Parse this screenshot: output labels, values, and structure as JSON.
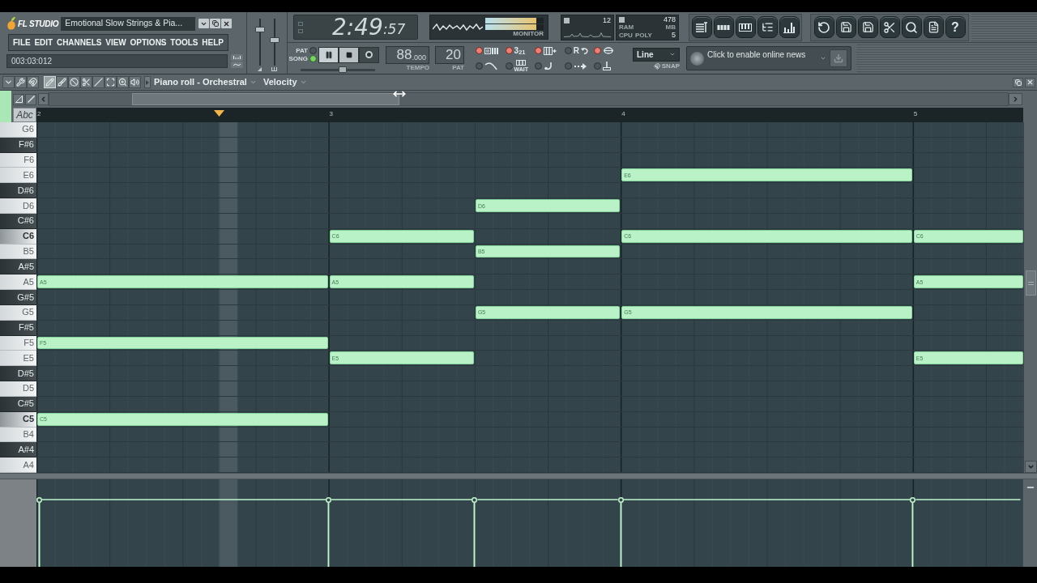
{
  "title_bar": {
    "app_name": "FL STUDIO",
    "song_title": "Emotional Slow Strings & Pia..."
  },
  "menu": [
    {
      "label": "FILE"
    },
    {
      "label": "EDIT"
    },
    {
      "label": "CHANNELS"
    },
    {
      "label": "VIEW"
    },
    {
      "label": "OPTIONS"
    },
    {
      "label": "TOOLS"
    },
    {
      "label": "HELP"
    }
  ],
  "hint_bar": {
    "text": "003:03:012"
  },
  "master_sliders": [
    {
      "kind": "volume",
      "level": 0.8
    },
    {
      "kind": "pitch",
      "level": 0.55
    }
  ],
  "time_display": {
    "main": "2:49",
    "small": ":57"
  },
  "monitor": {
    "label": "MONITOR",
    "meters": [
      {
        "level": 0.88
      },
      {
        "level": 0.88
      }
    ]
  },
  "cpu": {
    "value": "12",
    "ram": "478",
    "ram_label": "RAM",
    "unit": "MB",
    "cpu_label": "CPU",
    "poly_label": "POLY",
    "poly": "5"
  },
  "view_buttons": [
    {
      "kind": "playlist"
    },
    {
      "kind": "step-sequencer"
    },
    {
      "kind": "piano-roll"
    },
    {
      "kind": "browser"
    },
    {
      "kind": "mixer"
    }
  ],
  "tool_buttons": [
    {
      "kind": "undo"
    },
    {
      "kind": "save-new"
    },
    {
      "kind": "export"
    },
    {
      "kind": "cut"
    },
    {
      "kind": "search"
    },
    {
      "kind": "info"
    },
    {
      "kind": "help",
      "label": "?"
    }
  ],
  "transport": {
    "modes": [
      {
        "label": "PAT",
        "selected": false
      },
      {
        "label": "SONG",
        "selected": true
      }
    ],
    "buttons": [
      {
        "kind": "pause"
      },
      {
        "kind": "stop"
      },
      {
        "kind": "record"
      }
    ],
    "position": {
      "level": 0.57
    }
  },
  "tempo": {
    "value": "88",
    "decimals": ".000",
    "label": "TEMPO"
  },
  "pattern": {
    "value": "20",
    "label": "PAT"
  },
  "toggles": [
    {
      "kind": "metronome",
      "on": true
    },
    {
      "kind": "countdown",
      "label": "3$_{21}$",
      "on": true
    },
    {
      "kind": "step-edit",
      "on": true
    },
    {
      "kind": "recording",
      "label": "R",
      "on": false
    },
    {
      "kind": "loop",
      "on": true
    },
    {
      "kind": "blend",
      "on": false
    },
    {
      "kind": "wait",
      "label": "WAIT",
      "on": false
    },
    {
      "kind": "pedal",
      "on": false
    },
    {
      "kind": "arrow",
      "on": false
    },
    {
      "kind": "typing",
      "on": false
    }
  ],
  "snap": {
    "value": "Line",
    "label": "SNAP"
  },
  "news": {
    "text": "Click to enable online news"
  },
  "piano_roll": {
    "tools": [
      {
        "kind": "menu",
        "selected": false
      },
      {
        "kind": "settings",
        "selected": false
      },
      {
        "kind": "snap",
        "selected": false
      },
      {
        "kind": "draw",
        "selected": true
      },
      {
        "kind": "paint",
        "selected": false
      },
      {
        "kind": "mute",
        "selected": false
      },
      {
        "kind": "slice",
        "selected": false
      },
      {
        "kind": "slip",
        "selected": false
      },
      {
        "kind": "select",
        "selected": false
      },
      {
        "kind": "zoom",
        "selected": false
      },
      {
        "kind": "playback",
        "selected": false
      }
    ],
    "title": "Piano roll - Orchestral",
    "target": "Velocity",
    "abc": "Abc",
    "bars": [
      {
        "label": "2"
      },
      {
        "label": "3"
      },
      {
        "label": "4"
      },
      {
        "label": "5"
      }
    ],
    "marker": {
      "level": 0.185
    },
    "keys": [
      {
        "label": "G6",
        "kind": "white"
      },
      {
        "label": "F#6",
        "kind": "black"
      },
      {
        "label": "F6",
        "kind": "white"
      },
      {
        "label": "E6",
        "kind": "white",
        "notes": [
          {
            "kind": "gap_bar"
          },
          {
            "kind": "gap_bar"
          },
          {
            "kind": "bar",
            "label": "E6"
          }
        ]
      },
      {
        "label": "D#6",
        "kind": "black"
      },
      {
        "label": "D6",
        "kind": "white",
        "notes": [
          {
            "kind": "gap_bar"
          },
          {
            "kind": "gap_half"
          },
          {
            "kind": "half",
            "label": "D6"
          }
        ]
      },
      {
        "label": "C#6",
        "kind": "black"
      },
      {
        "label": "C6",
        "kind": "octave",
        "notes": [
          {
            "kind": "gap_bar"
          },
          {
            "kind": "half",
            "label": "C6"
          },
          {
            "kind": "gap_half"
          },
          {
            "kind": "bar",
            "label": "C6"
          },
          {
            "kind": "half",
            "label": "C6"
          }
        ]
      },
      {
        "label": "B5",
        "kind": "white",
        "notes": [
          {
            "kind": "gap_bar"
          },
          {
            "kind": "gap_half"
          },
          {
            "kind": "half",
            "label": "B5"
          }
        ]
      },
      {
        "label": "A#5",
        "kind": "black"
      },
      {
        "label": "A5",
        "kind": "white",
        "notes": [
          {
            "kind": "bar",
            "label": "A5"
          },
          {
            "kind": "half",
            "label": "A5"
          },
          {
            "kind": "gap_half"
          },
          {
            "kind": "gap_bar"
          },
          {
            "kind": "half",
            "label": "A5"
          }
        ]
      },
      {
        "label": "G#5",
        "kind": "black"
      },
      {
        "label": "G5",
        "kind": "white",
        "notes": [
          {
            "kind": "gap_bar"
          },
          {
            "kind": "gap_half"
          },
          {
            "kind": "half",
            "label": "G5"
          },
          {
            "kind": "bar",
            "label": "G5"
          }
        ]
      },
      {
        "label": "F#5",
        "kind": "black"
      },
      {
        "label": "F5",
        "kind": "white",
        "notes": [
          {
            "kind": "bar",
            "label": "F5"
          }
        ]
      },
      {
        "label": "E5",
        "kind": "white",
        "notes": [
          {
            "kind": "gap_bar"
          },
          {
            "kind": "half",
            "label": "E5"
          },
          {
            "kind": "gap_half"
          },
          {
            "kind": "gap_bar"
          },
          {
            "kind": "half",
            "label": "E5"
          }
        ]
      },
      {
        "label": "D#5",
        "kind": "black"
      },
      {
        "label": "D5",
        "kind": "white"
      },
      {
        "label": "C#5",
        "kind": "black"
      },
      {
        "label": "C5",
        "kind": "octave",
        "notes": [
          {
            "kind": "bar",
            "label": "C5"
          }
        ]
      },
      {
        "label": "B4",
        "kind": "white"
      },
      {
        "label": "A#4",
        "kind": "black"
      },
      {
        "label": "A4",
        "kind": "white"
      }
    ],
    "velocity": [
      {
        "kind": "bar",
        "level": 0.8
      },
      {
        "kind": "half",
        "level": 0.8
      },
      {
        "kind": "half",
        "level": 0.8
      },
      {
        "kind": "bar",
        "level": 0.8
      },
      {
        "kind": "half",
        "level": 0.8
      }
    ]
  }
}
